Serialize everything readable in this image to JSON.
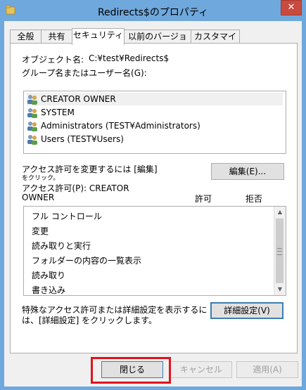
{
  "window": {
    "title": "Redirects$のプロパティ",
    "close_glyph": "✕"
  },
  "tabs": [
    "全般",
    "共有",
    "セキュリティ",
    "以前のバージョン",
    "カスタマイズ"
  ],
  "object": {
    "label": "オブジェクト名:",
    "value": "C:¥test¥Redirects$"
  },
  "group_label": "グループ名またはユーザー名(G):",
  "users": [
    "CREATOR OWNER",
    "SYSTEM",
    "Administrators (TEST¥Administrators)",
    "Users (TEST¥Users)"
  ],
  "change_text": {
    "line1": "アクセス許可を変更するには [編集]",
    "line2": "をクリック。"
  },
  "edit_button": "編集(E)...",
  "perm_header": {
    "line1": "アクセス許可(P): CREATOR",
    "line2": "OWNER",
    "allow": "許可",
    "deny": "拒否"
  },
  "permissions": [
    "フル コントロール",
    "変更",
    "読み取りと実行",
    "フォルダーの内容の一覧表示",
    "読み取り",
    "書き込み"
  ],
  "advanced_text": {
    "line1": "特殊なアクセス許可または詳細設定を表示するに",
    "line2": "は、[詳細設定] をクリックします。"
  },
  "advanced_button": "詳細設定(V)",
  "footer": {
    "close": "閉じる",
    "cancel": "キャンセル",
    "apply": "適用(A)"
  },
  "colors": {
    "frame": "#6fa8dc",
    "close_button": "#c94a3f",
    "highlight": "#e0141e"
  }
}
